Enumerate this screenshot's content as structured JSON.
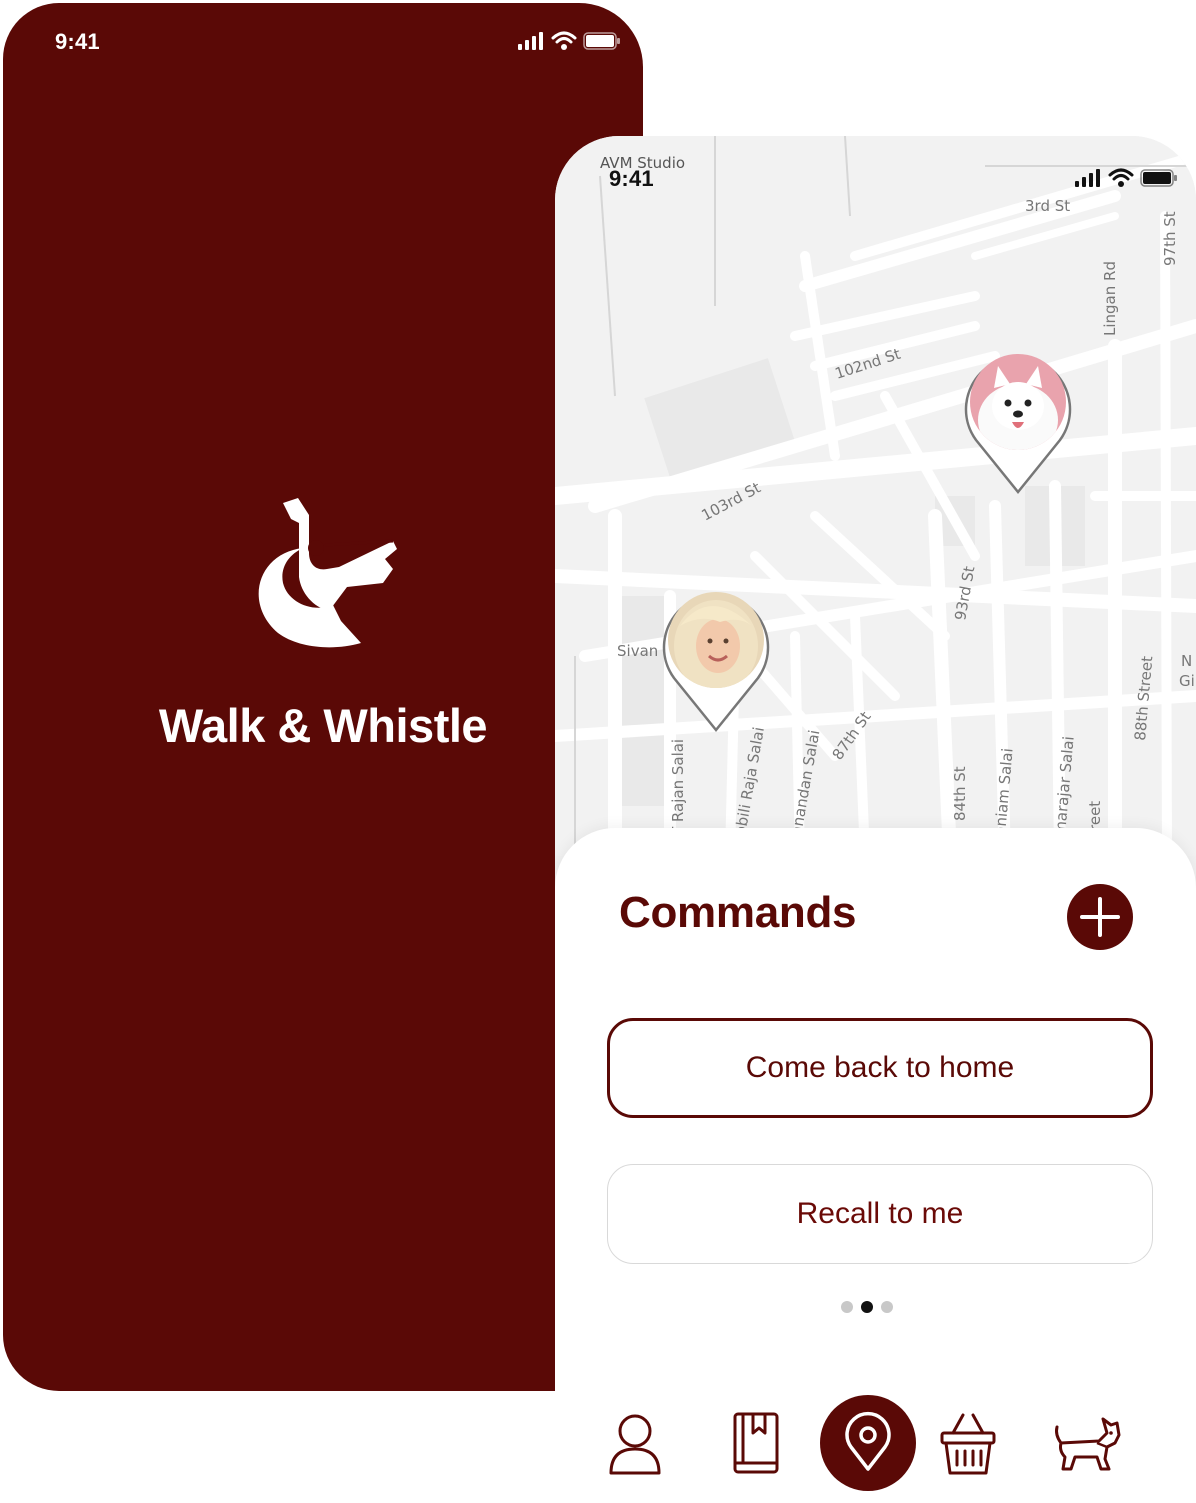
{
  "splash": {
    "status_time": "9:41",
    "brand_name": "Walk & Whistle",
    "background_color": "#5a0906"
  },
  "map_screen": {
    "status_time": "9:41",
    "studio_label": "AVM Studio",
    "map_labels": {
      "third_st": "3rd St",
      "st97": "97th St",
      "lingan": "Lingan Rd",
      "st102": "102nd St",
      "st103": "103rd St",
      "sivan": "Sivan",
      "rajan": "T Rajan Salai",
      "raja": "obili Raja Salai",
      "anandan": "anandan Salai",
      "st87": "87th St",
      "st93": "93rd St",
      "st84": "84th St",
      "aniam": "aniam Salai",
      "marajar": "marajar Salai",
      "reet": "reet",
      "street88": "88th Street",
      "ng": "N",
      "gi": "Gi"
    },
    "pins": [
      {
        "name": "dog-pin",
        "subject": "white dog photo"
      },
      {
        "name": "owner-pin",
        "subject": "owner photo"
      }
    ],
    "sheet": {
      "title": "Commands",
      "commands": [
        "Come back to home",
        "Recall to me"
      ],
      "page_count": 3,
      "active_page": 2
    },
    "tabs": [
      {
        "name": "profile",
        "icon": "person-icon"
      },
      {
        "name": "journal",
        "icon": "book-icon"
      },
      {
        "name": "map",
        "icon": "location-pin-icon",
        "active": true
      },
      {
        "name": "shop",
        "icon": "basket-icon"
      },
      {
        "name": "dog",
        "icon": "dog-icon"
      }
    ],
    "accent_color": "#5a0906"
  }
}
